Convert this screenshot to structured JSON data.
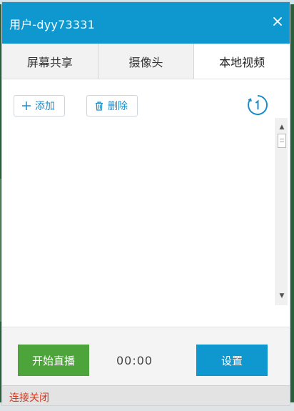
{
  "window": {
    "title": "用户-dyy73331",
    "close_icon": "close-icon"
  },
  "tabs": [
    {
      "label": "屏幕共享",
      "active": false
    },
    {
      "label": "摄像头",
      "active": false
    },
    {
      "label": "本地视频",
      "active": true
    }
  ],
  "toolbar": {
    "add_label": "添加",
    "add_icon": "plus-icon",
    "delete_label": "删除",
    "delete_icon": "trash-icon",
    "loop_icon": "repeat-once-icon"
  },
  "video_list": {
    "items": []
  },
  "footer": {
    "start_live_label": "开始直播",
    "timer": "00:00",
    "settings_label": "设置"
  },
  "status": {
    "text": "连接关闭"
  },
  "colors": {
    "accent": "#0f97d0",
    "live_button": "#4da43a",
    "status_text": "#d4381d"
  }
}
